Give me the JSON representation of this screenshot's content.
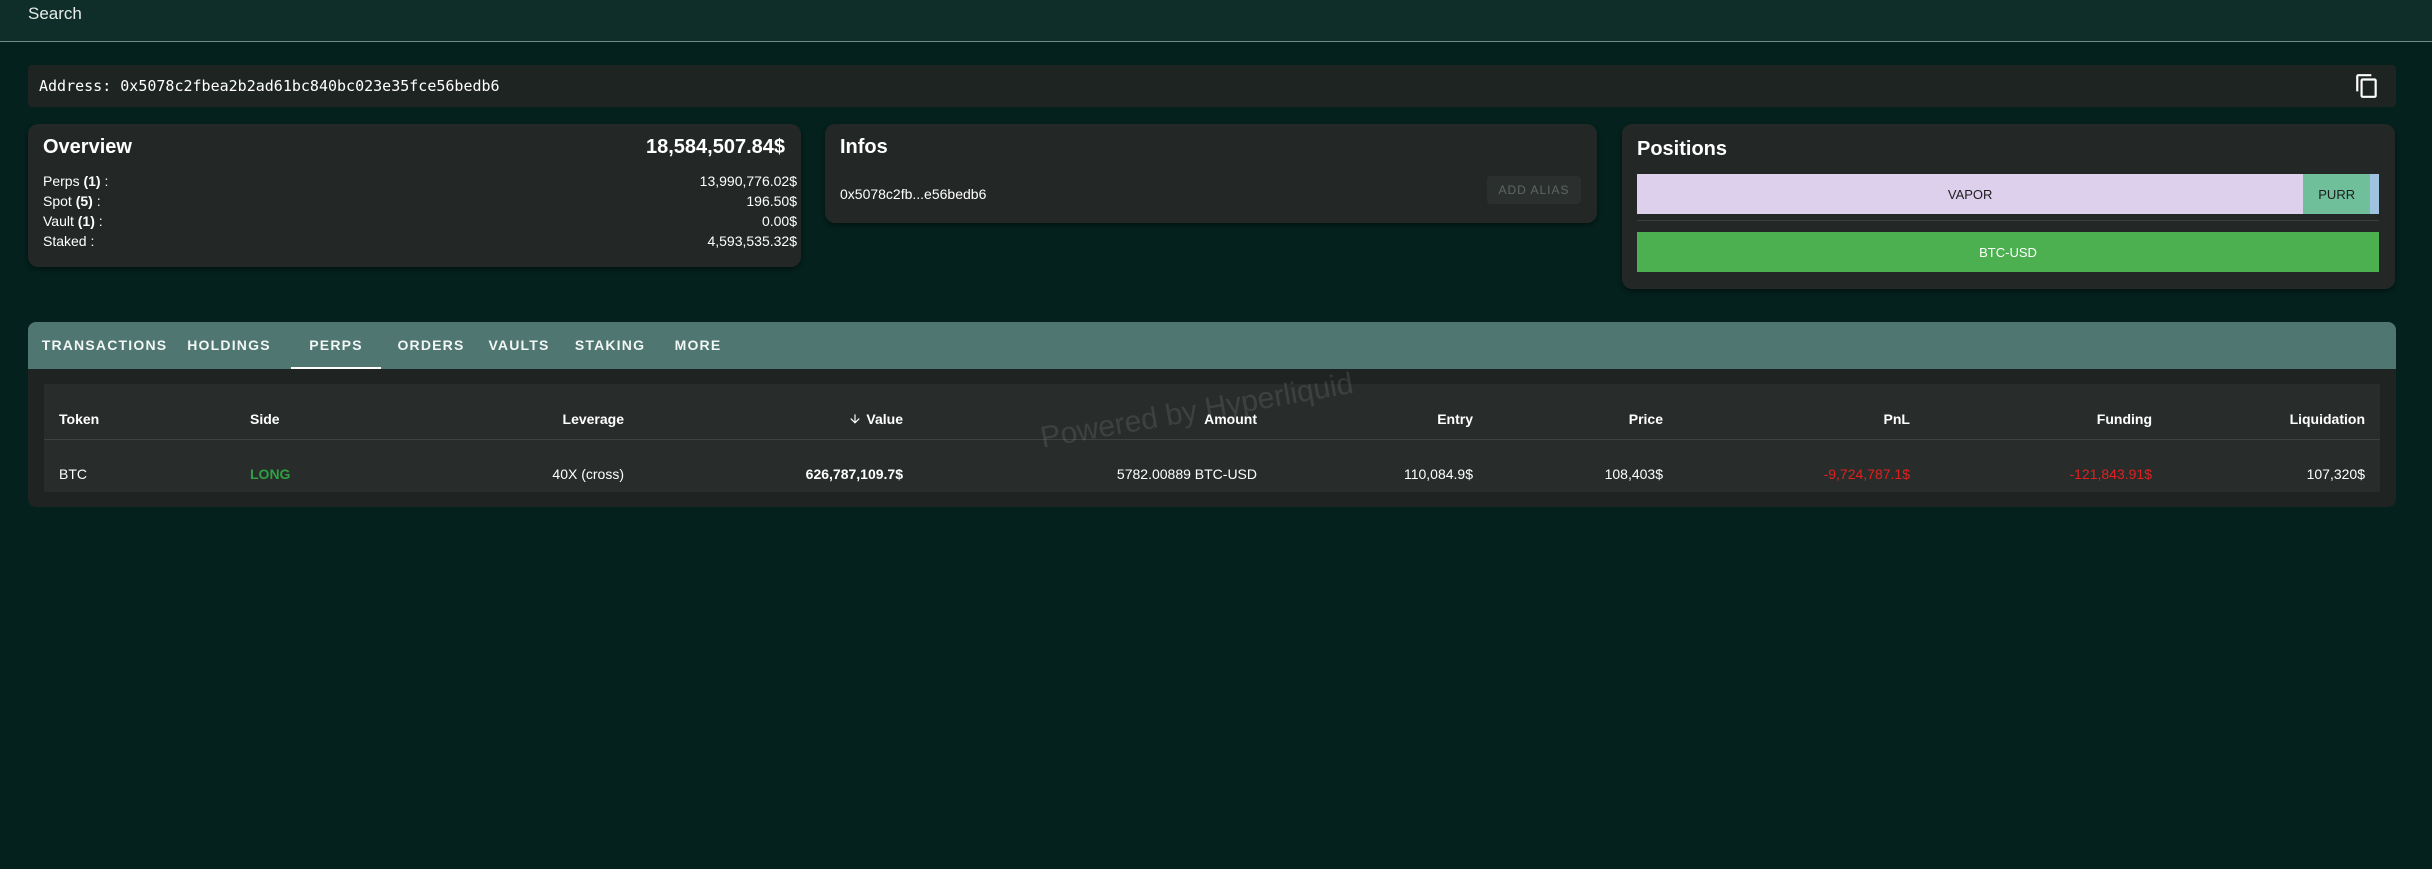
{
  "search": {
    "placeholder": "Search"
  },
  "address": {
    "text": "Address: 0x5078c2fbea2b2ad61bc840bc023e35fce56bedb6"
  },
  "overview": {
    "title": "Overview",
    "total": "18,584,507.84$",
    "rows": [
      {
        "name": "Perps",
        "count": "(1)",
        "suffix": " :",
        "value": "13,990,776.02$"
      },
      {
        "name": "Spot",
        "count": "(5)",
        "suffix": " :",
        "value": "196.50$"
      },
      {
        "name": "Vault",
        "count": "(1)",
        "suffix": " :",
        "value": "0.00$"
      },
      {
        "name": "Staked",
        "count": "",
        "suffix": " :",
        "value": "4,593,535.32$"
      }
    ]
  },
  "infos": {
    "title": "Infos",
    "short_address": "0x5078c2fb...e56bedb6",
    "add_alias_label": "ADD ALIAS"
  },
  "positions": {
    "title": "Positions",
    "spot_segments": [
      {
        "label": "VAPOR",
        "share": 0.898,
        "color": "#dcd0ec"
      },
      {
        "label": "PURR",
        "share": 0.09,
        "color": "#6fbf9a"
      },
      {
        "label": "",
        "share": 0.012,
        "color": "#9ec2e0"
      }
    ],
    "perp_segments": [
      {
        "label": "BTC-USD",
        "share": 1.0,
        "color": "#4caf50"
      }
    ]
  },
  "tabs": [
    "TRANSACTIONS",
    "HOLDINGS",
    "PERPS",
    "ORDERS",
    "VAULTS",
    "STAKING",
    "MORE"
  ],
  "active_tab": "PERPS",
  "table": {
    "headers": {
      "token": "Token",
      "side": "Side",
      "leverage": "Leverage",
      "value": "Value",
      "amount": "Amount",
      "entry": "Entry",
      "price": "Price",
      "pnl": "PnL",
      "funding": "Funding",
      "liquidation": "Liquidation"
    },
    "rows": [
      {
        "token": "BTC",
        "side": "LONG",
        "leverage": "40X (cross)",
        "value": "626,787,109.7$",
        "amount": "5782.00889 BTC-USD",
        "entry": "110,084.9$",
        "price": "108,403$",
        "pnl": "-9,724,787.1$",
        "funding": "-121,843.91$",
        "liquidation": "107,320$"
      }
    ]
  },
  "watermark": "Powered by Hyperliquid",
  "colors": {
    "background": "#04211d",
    "tab_bar": "#4f7670",
    "positive": "#2ea043",
    "negative": "#e0201f",
    "perp_bar": "#4caf50"
  }
}
